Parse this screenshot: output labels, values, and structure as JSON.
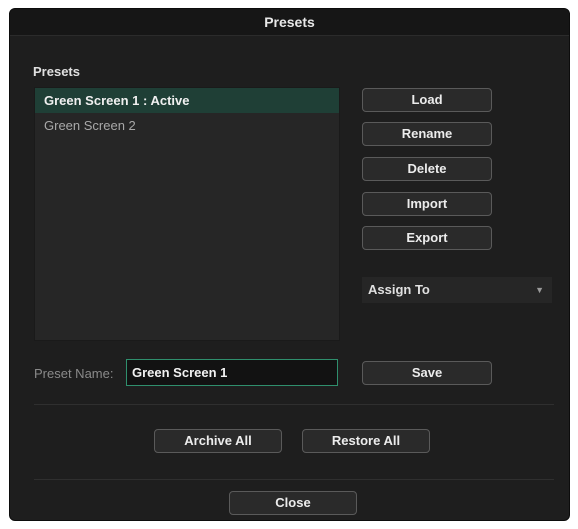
{
  "dialog": {
    "title": "Presets"
  },
  "presets_section": {
    "label": "Presets",
    "items": [
      {
        "label": "Green Screen 1 : Active",
        "selected": true
      },
      {
        "label": "Green Screen 2",
        "selected": false
      }
    ]
  },
  "actions": {
    "load": "Load",
    "rename": "Rename",
    "delete": "Delete",
    "import": "Import",
    "export": "Export"
  },
  "assign_to": {
    "selected": "Assign To",
    "caret_icon": "chevron-down-icon"
  },
  "preset_name": {
    "label": "Preset Name:",
    "value": "Green Screen 1"
  },
  "save_label": "Save",
  "archive_all_label": "Archive All",
  "restore_all_label": "Restore All",
  "close_label": "Close",
  "colors": {
    "background": "#1e1e1e",
    "selection": "#1f3f36",
    "input_focus_border": "#2f8f6d"
  }
}
